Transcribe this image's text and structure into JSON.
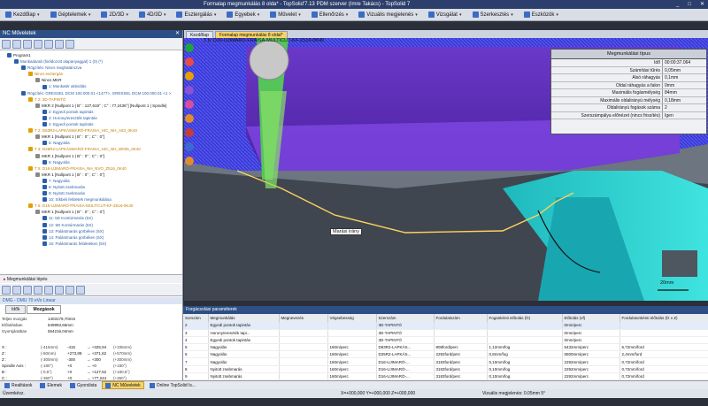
{
  "titlebar": {
    "title": "Formalap megmunkálás 8 olda* - TopSolid'7.13 PDM szerver (Imre Takács) - TopSolid 7",
    "min": "_",
    "max": "□",
    "close": "✕"
  },
  "menubar": [
    {
      "label": "Kezdőlap",
      "icon": "home-icon"
    },
    {
      "label": "Géptelemek",
      "icon": "machine-icon"
    },
    {
      "label": "2D/3D",
      "icon": "2d3d-icon"
    },
    {
      "label": "4D/3D",
      "icon": "4d3d-icon"
    },
    {
      "label": "Esztergálás",
      "icon": "lathe-icon"
    },
    {
      "label": "Egyebek",
      "icon": "misc-icon"
    },
    {
      "label": "Művelet",
      "icon": "operation-icon"
    },
    {
      "label": "Ellenőrzés",
      "icon": "check-icon"
    },
    {
      "label": "Vizuális megjelenés",
      "icon": "visual-icon"
    },
    {
      "label": "Vizsgálat",
      "icon": "inspect-icon"
    },
    {
      "label": "Szerkesztés",
      "icon": "edit-icon"
    },
    {
      "label": "Eszközök",
      "icon": "tools-icon"
    }
  ],
  "leftpanel": {
    "title": "NC Műveletek",
    "close": "✕"
  },
  "tree": [
    {
      "text": "Program1",
      "cls": "",
      "indent": 1,
      "color": "#2b5fa8"
    },
    {
      "text": "Munkadarab (hiéldozott alapanyaggal) 1 (0) (*)",
      "cls": "sub",
      "indent": 2,
      "color": "#2b5fa8"
    },
    {
      "text": "Rögzítés: Nincs meghatározva",
      "cls": "sub",
      "indent": 3,
      "color": "#2b5fa8"
    },
    {
      "text": "Nincs esztergán",
      "cls": "op",
      "indent": 4,
      "color": "#e0a000"
    },
    {
      "text": "Nincs MKR",
      "cls": "",
      "indent": 5,
      "color": "#888"
    },
    {
      "text": "1: Munkatér aktiválás",
      "cls": "sub",
      "indent": 6,
      "color": "#2b5fa8"
    },
    {
      "text": "Rögzítés: GRESSEL DCM 100.000.01 <1477>, GRESSEL DCM 100.000.01 <1 >",
      "cls": "sub",
      "indent": 3,
      "color": "#2b5fa8"
    },
    {
      "text": "T 2: 3D-TAPINTÓ",
      "cls": "op",
      "indent": 4,
      "color": "#e0a000"
    },
    {
      "text": "MKR 2 [Nullpont 1 | B° : 127,619° ; C° : 77,2436°] [Nullpont 1 | Spindle]",
      "cls": "",
      "indent": 5,
      "color": "#888"
    },
    {
      "text": "2: Egyedi pontok tapintás",
      "cls": "sub",
      "indent": 6,
      "color": "#2b5fa8"
    },
    {
      "text": "3: Horony/ereszték tapintás",
      "cls": "sub",
      "indent": 6,
      "color": "#2b5fa8"
    },
    {
      "text": "4: Egyedi pontok tapintás",
      "cls": "sub",
      "indent": 6,
      "color": "#2b5fa8"
    },
    {
      "text": "T 2: D63R2-LAPKÁSMARÓ-FRAISA_H/C_NH_A63_0K40",
      "cls": "op",
      "indent": 4,
      "color": "#e0a000"
    },
    {
      "text": "MKR 1 [Nullpont 1 | B° : 0° ; C° : 0°]",
      "cls": "",
      "indent": 5,
      "color": "#888"
    },
    {
      "text": "5: Nagyolás",
      "cls": "sub",
      "indent": 6,
      "color": "#2b5fa8"
    },
    {
      "text": "T 3: D25R2-LAPKÁSMARÓ-FRAISA_H/C_NH_W025_0K40",
      "cls": "op",
      "indent": 4,
      "color": "#e0a000"
    },
    {
      "text": "MKR 1 [Nullpont 1 | B° : 0° ; C° : 0°]",
      "cls": "",
      "indent": 5,
      "color": "#888"
    },
    {
      "text": "6: Nagyolás",
      "cls": "sub",
      "indent": 6,
      "color": "#2b5fa8"
    },
    {
      "text": "T 5: D16-UJIMARÓ-FRAISA_NH_NVO_Z516_0K40",
      "cls": "op",
      "indent": 4,
      "color": "#e0a000"
    },
    {
      "text": "MKR 1 [Nullpont 1 | B° : 0° ; C° : 0°]",
      "cls": "",
      "indent": 5,
      "color": "#888"
    },
    {
      "text": "7: Nagyolás",
      "cls": "sub",
      "indent": 6,
      "color": "#2b5fa8"
    },
    {
      "text": "8: Nyitott zsebmarás",
      "cls": "sub",
      "indent": 6,
      "color": "#2b5fa8"
    },
    {
      "text": "9: Nyitott zsebmarás",
      "cls": "sub",
      "indent": 6,
      "color": "#2b5fa8"
    },
    {
      "text": "10: Síkbeli felületek megmunkálása",
      "cls": "sub",
      "indent": 6,
      "color": "#2b5fa8"
    },
    {
      "text": "T 6: D16-UJIMARÓ-FRAISA-MULTICUT-KF-Z516-0K40",
      "cls": "op",
      "indent": 4,
      "color": "#e0a000"
    },
    {
      "text": "MKR 1 [Nullpont 1 | B° : 0° ; C° : 0°]",
      "cls": "",
      "indent": 5,
      "color": "#888"
    },
    {
      "text": "11: 5D Kontúrmarás (5X)",
      "cls": "sub",
      "indent": 6,
      "color": "#2b5fa8"
    },
    {
      "text": "12: 5D Kontúrmarás (5X)",
      "cls": "sub",
      "indent": 6,
      "color": "#2b5fa8"
    },
    {
      "text": "13: Palástmarás görbéken (5X)",
      "cls": "sub",
      "indent": 6,
      "color": "#2b5fa8"
    },
    {
      "text": "14: Palástmarás görbéken (5X)",
      "cls": "sub",
      "indent": 6,
      "color": "#2b5fa8"
    },
    {
      "text": "15: Palástmarás felületeken (5X)",
      "cls": "sub",
      "indent": 6,
      "color": "#2b5fa8"
    }
  ],
  "machining_step": "Megmunkálási lépés",
  "dmg": {
    "title": "DMG - DMU 70 eVo Linear",
    "tab_times": "Idők",
    "tab_moves": "Mozgások"
  },
  "stats": [
    {
      "k": "Teljes mozgás",
      "v": "1403179,70mm"
    },
    {
      "k": "Előtolásban",
      "v": "849993,66mm"
    },
    {
      "k": "Gyorsjáratban",
      "v": "554216,04mm"
    }
  ],
  "axes": [
    {
      "ax": "X :",
      "a1": "(-415mm)",
      "a2": "-415",
      "a3": "→ +325,94",
      "a4": "(+335mm)"
    },
    {
      "ax": "Z :",
      "a1": "(-50mm)",
      "a2": "+273,89",
      "a3": "→ +371,62",
      "a4": "(+570mm)"
    },
    {
      "ax": "Z :",
      "a1": "(-300mm)",
      "a2": "-300",
      "a3": "→ +300",
      "a4": "(+300mm)"
    },
    {
      "ax": "Spindle Axis :",
      "a1": "(-180°)",
      "a2": "+0",
      "a3": "→ +0",
      "a4": "(+180°)"
    },
    {
      "ax": "B :",
      "a1": "(-0,5°)",
      "a2": "+0",
      "a3": "→ +127,62",
      "a4": "(+180,5°)"
    },
    {
      "ax": "C :",
      "a1": "(-360°)",
      "a2": "+0",
      "a3": "→ +77,244",
      "a4": "(+360°)"
    }
  ],
  "viewtabs": [
    {
      "label": "Kezdőlap",
      "active": false
    },
    {
      "label": "Formalap megmunkálás 8 oldal*",
      "active": true
    }
  ],
  "viewport": {
    "tool_label": "T 6: D16-UJIMARÓ-FRAISA-MULTICUT-KF-Z516-0K40",
    "direction_label": "Marási irány",
    "scale_label": "20mm"
  },
  "params": {
    "header": "Megmunkálási típus",
    "rows": [
      {
        "k": "Idő",
        "v": "00:00:37.064"
      },
      {
        "k": "Számítási tűrés",
        "v": "0,05mm"
      },
      {
        "k": "Alsó ráhagyás",
        "v": "0,1mm"
      },
      {
        "k": "Oldal ráhagyás a falon",
        "v": "0mm"
      },
      {
        "k": "Maximális fogásmélység",
        "v": "84mm"
      },
      {
        "k": "Maximális oldalirányú mélység",
        "v": "0,18mm"
      },
      {
        "k": "Oldalirányú fogások száma",
        "v": "2"
      },
      {
        "k": "Szerszámpálya előnézet (nincs frissítés)",
        "v": "Igen"
      }
    ]
  },
  "table": {
    "title": "Forgácsolási paraméterek",
    "headers": [
      "Sorszám",
      "Megmunkálás",
      "Megnevezés",
      "Végsebesség",
      "Szerszám",
      "Fordulatszám",
      "Fogankénti előtolás (fz)",
      "Előtolás (vf)",
      "Fordulatonkénti előtolás (fz x Z)"
    ],
    "rows": [
      [
        "2",
        "Egyedi pontok tapintás",
        "",
        "",
        "3D-TAPINTÓ",
        "",
        "",
        "0mm/perc",
        ""
      ],
      [
        "3",
        "Horony/ereszték tapi...",
        "",
        "",
        "3D-TAPINTÓ",
        "",
        "",
        "0mm/perc",
        ""
      ],
      [
        "4",
        "Egyedi pontok tapintás",
        "",
        "",
        "3D-TAPINTÓ",
        "",
        "",
        "0mm/perc",
        ""
      ],
      [
        "5",
        "Nagyolás",
        "",
        "160m/perc",
        "D63R2-LAPKÁS...",
        "808ford/perc",
        "1,12mm/fog",
        "5432mm/perc",
        "6,72mm/ford"
      ],
      [
        "6",
        "Nagyolás",
        "",
        "160m/perc",
        "D25R2-LAPKÁS...",
        "2292ford/perc",
        "0,8mm/fog",
        "5500mm/perc",
        "2,4mm/ford"
      ],
      [
        "7",
        "Nagyolás",
        "",
        "160m/perc",
        "D16-UJIMARÓ-...",
        "3183ford/perc",
        "0,10mm/fog",
        "2292mm/perc",
        "0,72mm/ford"
      ],
      [
        "8",
        "Nyitott zsebmarás",
        "",
        "160m/perc",
        "D16-UJIMARÓ-...",
        "3183ford/perc",
        "0,10mm/fog",
        "2292mm/perc",
        "0,72mm/ford"
      ],
      [
        "9",
        "Nyitott zsebmarás",
        "",
        "160m/perc",
        "D16-UJIMARÓ-...",
        "3183ford/perc",
        "0,10mm/fog",
        "2292mm/perc",
        "0,72mm/ford"
      ]
    ]
  },
  "bottomtabs": [
    {
      "label": "Realitások",
      "active": false
    },
    {
      "label": "Elemek",
      "active": false
    },
    {
      "label": "Gyorslista",
      "active": false
    },
    {
      "label": "NC Műveletek",
      "active": true
    },
    {
      "label": "Online TopSolid Is...",
      "active": false
    }
  ],
  "status": {
    "left": "Üzemkész.",
    "coords": "X=+000,000     Y=+000,000     Z=+000,000",
    "visual": "Vizuális megjelenés: 0.05mm 5°"
  },
  "colors": {
    "accent": "#2d4f86",
    "toolpath_blue": "#3c3cd6",
    "part_purple": "#7a3bd0",
    "part_cyan": "#2fd6d6",
    "active_tab": "#f6d36b"
  }
}
